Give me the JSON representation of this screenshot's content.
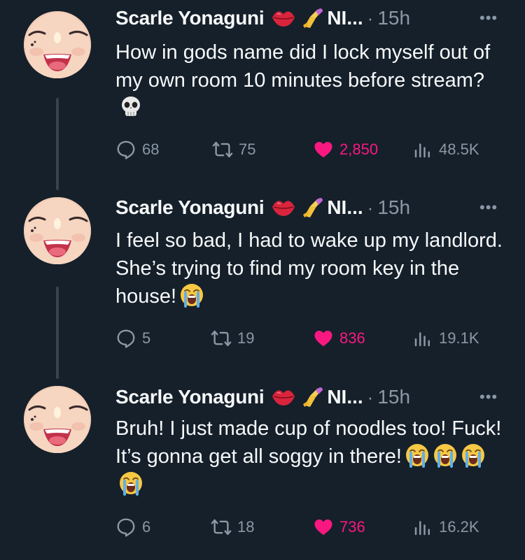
{
  "tweets": [
    {
      "author": "Scarle Yonaguni",
      "handle_truncated": "NI...",
      "separator": "·",
      "time": "15h",
      "more": "•••",
      "text": "How in gods name did I lock myself out of my own room 10 minutes before stream?",
      "text_emojis": [
        "skull-emoji"
      ],
      "replies": "68",
      "retweets": "75",
      "likes": "2,850",
      "views": "48.5K"
    },
    {
      "author": "Scarle Yonaguni",
      "handle_truncated": "NI...",
      "separator": "·",
      "time": "15h",
      "more": "•••",
      "text": "I feel so bad, I had to wake up my landlord. She’s trying to find my room key in the house!",
      "text_emojis": [
        "crying-face-emoji"
      ],
      "replies": "5",
      "retweets": "19",
      "likes": "836",
      "views": "19.1K"
    },
    {
      "author": "Scarle Yonaguni",
      "handle_truncated": "NI...",
      "separator": "·",
      "time": "15h",
      "more": "•••",
      "text": "Bruh! I just made cup of noodles too! Fuck! It’s gonna get all soggy in there!",
      "text_emojis": [
        "crying-face-emoji",
        "crying-face-emoji",
        "crying-face-emoji",
        "crying-face-emoji"
      ],
      "replies": "6",
      "retweets": "18",
      "likes": "736",
      "views": "16.2K"
    }
  ],
  "colors": {
    "background": "#15202b",
    "text": "#f7f9f9",
    "muted": "#8b98a5",
    "like": "#f91880",
    "thread_line": "#38444d"
  }
}
